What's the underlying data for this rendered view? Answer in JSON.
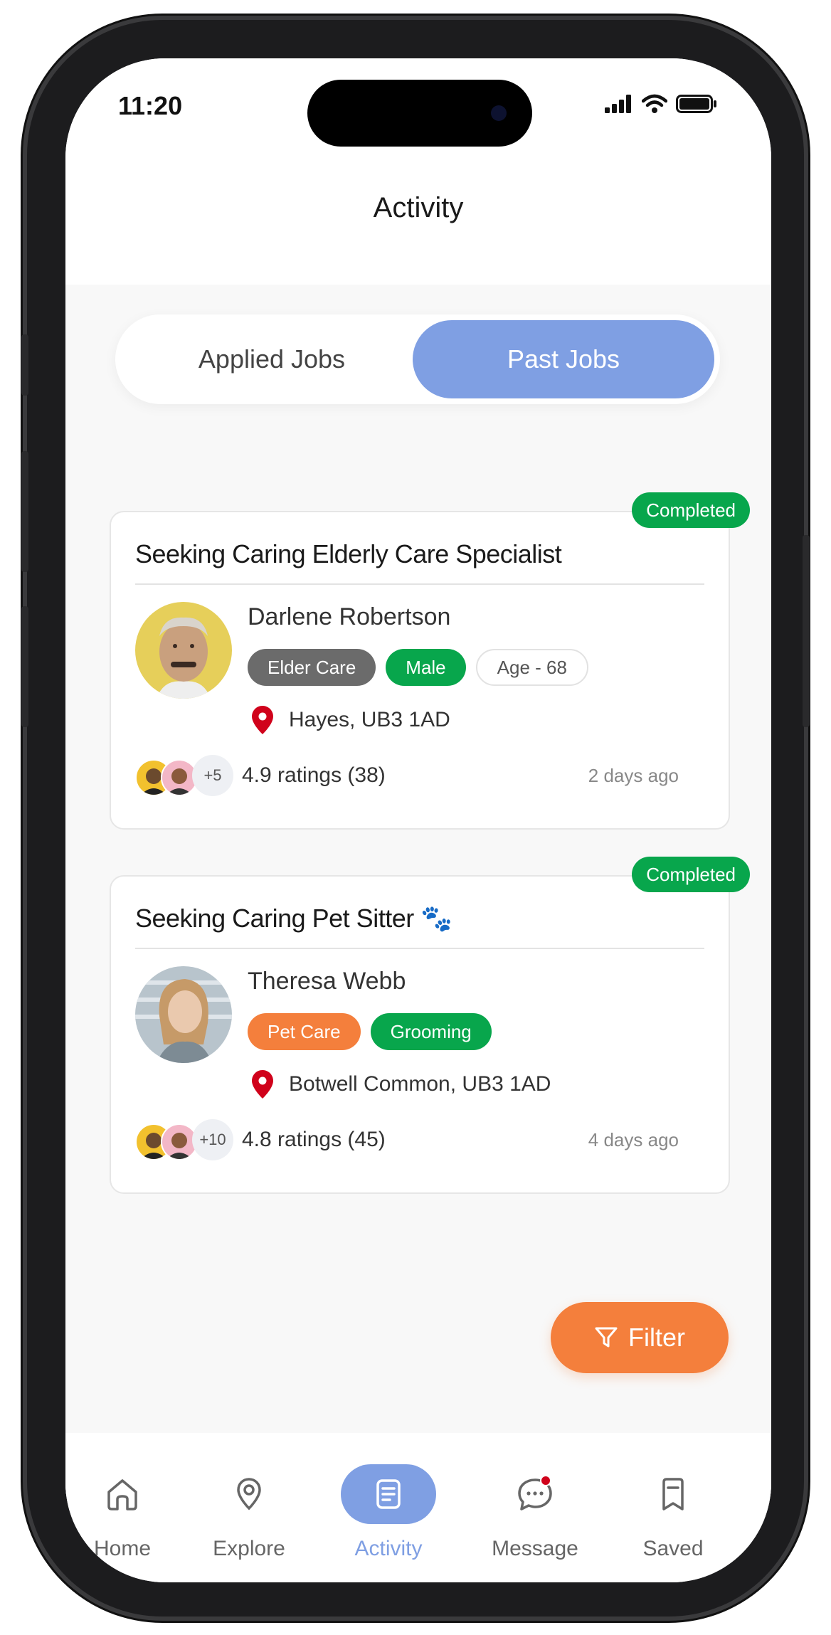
{
  "status_bar": {
    "time": "11:20"
  },
  "header": {
    "title": "Activity"
  },
  "tabs": [
    {
      "label": "Applied Jobs",
      "active": false
    },
    {
      "label": "Past Jobs",
      "active": true
    }
  ],
  "jobs": [
    {
      "status": "Completed",
      "title": "Seeking Caring Elderly Care Specialist",
      "person": "Darlene Robertson",
      "tags": [
        "Elder Care",
        "Male",
        "Age - 68"
      ],
      "location": "Hayes, UB3 1AD",
      "more_count": "+5",
      "rating": "4.9 ratings (38)",
      "posted": "2 days ago"
    },
    {
      "status": "Completed",
      "title": "Seeking Caring Pet Sitter 🐾",
      "person": "Theresa Webb",
      "tags": [
        "Pet Care",
        "Grooming"
      ],
      "location": "Botwell Common, UB3 1AD",
      "more_count": "+10",
      "rating": "4.8 ratings (45)",
      "posted": "4 days ago"
    }
  ],
  "filter_button": {
    "label": "Filter"
  },
  "nav": [
    {
      "label": "Home",
      "icon": "home-icon"
    },
    {
      "label": "Explore",
      "icon": "location-pin-icon"
    },
    {
      "label": "Activity",
      "icon": "document-icon",
      "active": true
    },
    {
      "label": "Message",
      "icon": "chat-bubble-icon"
    },
    {
      "label": "Saved",
      "icon": "bookmark-icon"
    }
  ],
  "colors": {
    "accent": "#7f9fe3",
    "success": "#08a64c",
    "orange": "#f47f3c",
    "pin": "#d0021b"
  }
}
